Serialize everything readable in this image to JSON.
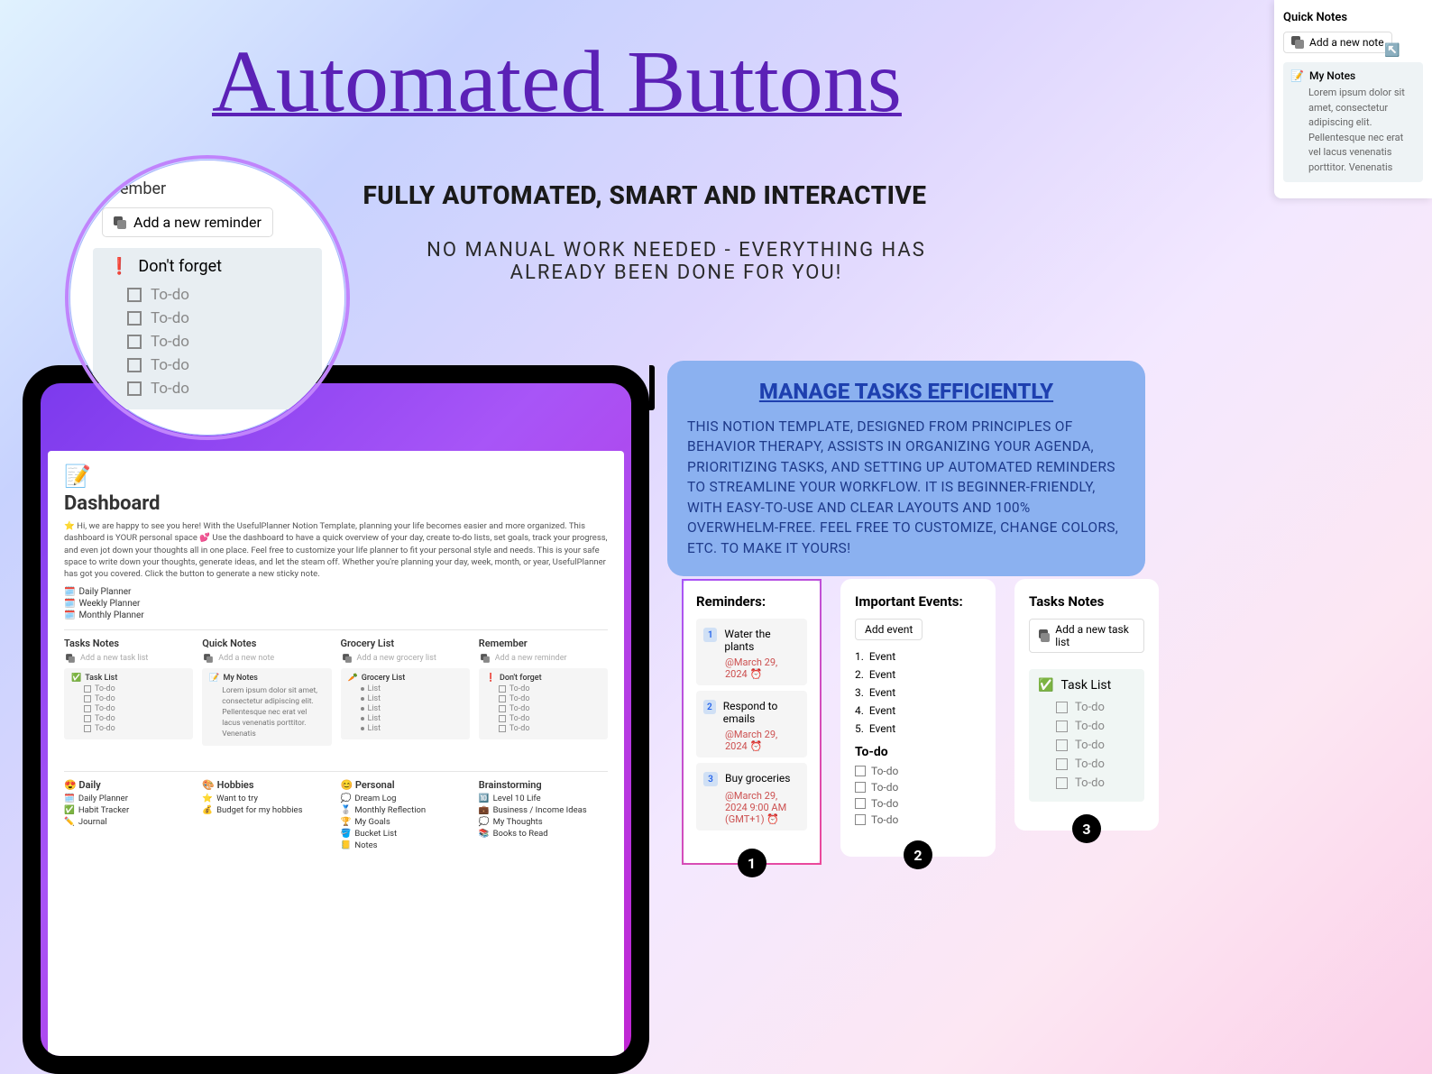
{
  "title": "Automated Buttons",
  "sub1": "FULLY AUTOMATED, SMART AND INTERACTIVE",
  "sub2": "NO MANUAL WORK NEEDED - EVERYTHING HAS ALREADY BEEN DONE FOR YOU!",
  "quick_notes": {
    "title": "Quick Notes",
    "button": "Add a new note",
    "note_title": "My Notes",
    "note_body": "Lorem ipsum dolor sit amet, consectetur adipiscing elit. Pellentesque nec erat vel lacus venenatis porttitor. Venenatis"
  },
  "zoom": {
    "header": "ember",
    "button": "Add a new reminder",
    "block_title": "Don't forget",
    "todo": "To-do",
    "todos": [
      "To-do",
      "To-do",
      "To-do",
      "To-do",
      "To-do"
    ]
  },
  "dashboard": {
    "title": "Dashboard",
    "intro": "⭐ Hi, we are happy to see you here! With the UsefulPlanner Notion Template, planning your life becomes easier and more organized. This dashboard is YOUR personal space 💕 Use the dashboard to have a quick overview of your day, create to-do lists, set goals, track your progress, and even jot down your thoughts all in one place. Feel free to customize your life planner to fit your personal style and needs. This is your safe space to write down your thoughts, generate ideas, and let the steam off. Whether you're planning your day, week, month, or year, UsefulPlanner has got you covered. Click the button to generate a new sticky note.",
    "links": [
      "Daily Planner",
      "Weekly Planner",
      "Monthly Planner"
    ],
    "cols": {
      "tasks": {
        "h": "Tasks Notes",
        "btn": "Add a new task list",
        "card_t": "Task List",
        "items": [
          "To-do",
          "To-do",
          "To-do",
          "To-do",
          "To-do"
        ]
      },
      "quick": {
        "h": "Quick Notes",
        "btn": "Add a new note",
        "card_t": "My Notes",
        "body": "Lorem ipsum dolor sit amet, consectetur adipiscing elit. Pellentesque nec erat vel lacus venenatis porttitor. Venenatis"
      },
      "grocery": {
        "h": "Grocery List",
        "btn": "Add a new grocery list",
        "card_t": "Grocery List",
        "items": [
          "List",
          "List",
          "List",
          "List",
          "List"
        ]
      },
      "remember": {
        "h": "Remember",
        "btn": "Add a new reminder",
        "card_t": "Don't forget",
        "items": [
          "To-do",
          "To-do",
          "To-do",
          "To-do",
          "To-do"
        ]
      }
    },
    "sections": {
      "daily": {
        "h": "😍 Daily",
        "items": [
          "Daily Planner",
          "Habit Tracker",
          "Journal"
        ],
        "icons": [
          "🗓️",
          "✅",
          "✏️"
        ]
      },
      "hobbies": {
        "h": "🎨 Hobbies",
        "items": [
          "Want to try",
          "Budget for my hobbies"
        ],
        "icons": [
          "⭐",
          "💰"
        ]
      },
      "personal": {
        "h": "😊 Personal",
        "items": [
          "Dream Log",
          "Monthly Reflection",
          "My Goals",
          "Bucket List",
          "Notes"
        ],
        "icons": [
          "💭",
          "🥈",
          "🏆",
          "🪣",
          "📒"
        ]
      },
      "brain": {
        "h": "Brainstorming",
        "items": [
          "Level 10 Life",
          "Business / Income Ideas",
          "My Thoughts",
          "Books to Read"
        ],
        "icons": [
          "🔟",
          "💼",
          "💭",
          "📚"
        ]
      }
    }
  },
  "blue": {
    "h": "MANAGE TASKS EFFICIENTLY",
    "p": "THIS NOTION TEMPLATE, DESIGNED FROM PRINCIPLES OF BEHAVIOR THERAPY, ASSISTS IN ORGANIZING YOUR AGENDA, PRIORITIZING TASKS, AND SETTING UP AUTOMATED REMINDERS TO STREAMLINE YOUR WORKFLOW. IT IS BEGINNER-FRIENDLY, WITH EASY-TO-USE AND CLEAR LAYOUTS AND 100% OVERWHELM-FREE. FEEL FREE TO CUSTOMIZE, CHANGE COLORS, ETC. TO MAKE IT YOURS!"
  },
  "card1": {
    "h": "Reminders:",
    "items": [
      {
        "n": "1",
        "t": "Water the plants",
        "d": "@March 29, 2024 ⏰"
      },
      {
        "n": "2",
        "t": "Respond to emails",
        "d": "@March 29, 2024 ⏰"
      },
      {
        "n": "3",
        "t": "Buy groceries",
        "d": "@March 29, 2024 9:00 AM (GMT+1) ⏰"
      }
    ],
    "badge": "1"
  },
  "card2": {
    "h": "Important Events:",
    "btn": "Add event",
    "events": [
      "Event",
      "Event",
      "Event",
      "Event",
      "Event"
    ],
    "sub": "To-do",
    "todos": [
      "To-do",
      "To-do",
      "To-do",
      "To-do"
    ],
    "badge": "2"
  },
  "card3": {
    "h": "Tasks Notes",
    "btn": "Add a new task list",
    "card_t": "Task List",
    "todos": [
      "To-do",
      "To-do",
      "To-do",
      "To-do",
      "To-do"
    ],
    "badge": "3"
  }
}
